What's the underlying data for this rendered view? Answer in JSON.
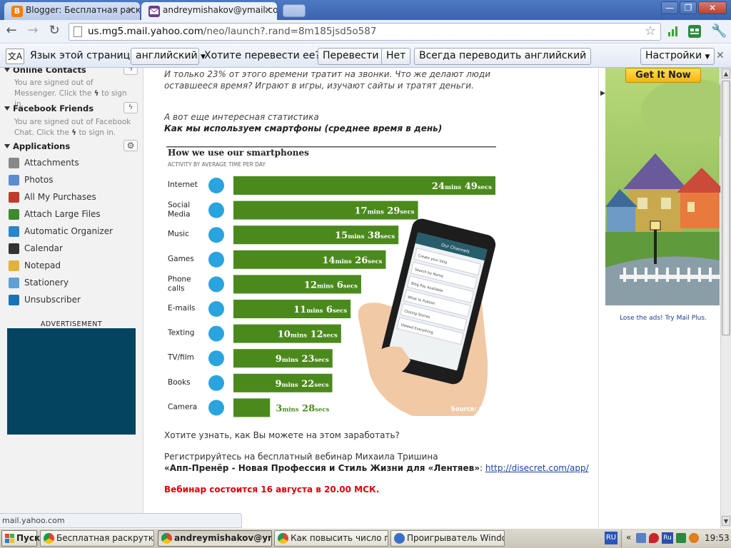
{
  "tabs": [
    {
      "title": "Blogger: Бесплатная раскру",
      "state": "inactive",
      "icon": "blogger-icon",
      "color": "#f57d00"
    },
    {
      "title": "andreymishakov@ymail.com - ",
      "state": "active",
      "icon": "yahoo-mail-icon",
      "color": "#6d3e91"
    }
  ],
  "window_controls": {
    "minimize": "—",
    "maximize": "❐",
    "close": "✕"
  },
  "address_bar": {
    "host": "us.mg5.mail.yahoo.com",
    "path": "/neo/launch?.rand=8m185jsd5o587"
  },
  "translate_bar": {
    "question": "Язык этой страницы",
    "language": "английский",
    "prompt": "Хотите перевести ее?",
    "translate_btn": "Перевести",
    "no_btn": "Нет",
    "always_btn": "Всегда переводить английский",
    "settings_btn": "Настройки"
  },
  "sidebar": {
    "online_contacts": {
      "title": "Online Contacts",
      "text_before": "You are signed out of Messenger. Click the",
      "text_after": "to sign in."
    },
    "facebook": {
      "title": "Facebook Friends",
      "text_before": "You are signed out of Facebook Chat. Click the",
      "text_after": "to sign in."
    },
    "applications": {
      "title": "Applications",
      "items": [
        {
          "label": "Attachments",
          "icon": "paperclip-icon",
          "color": "#888888"
        },
        {
          "label": "Photos",
          "icon": "photos-icon",
          "color": "#5a8ccf"
        },
        {
          "label": "All My Purchases",
          "icon": "purchases-icon",
          "color": "#c0392b"
        },
        {
          "label": "Attach Large Files",
          "icon": "plane-icon",
          "color": "#3c8a2e"
        },
        {
          "label": "Automatic Organizer",
          "icon": "oib-icon",
          "color": "#2b86c9"
        },
        {
          "label": "Calendar",
          "icon": "calendar-icon",
          "color": "#333333"
        },
        {
          "label": "Notepad",
          "icon": "notepad-icon",
          "color": "#e2b23a"
        },
        {
          "label": "Stationery",
          "icon": "stationery-icon",
          "color": "#5fa0d8"
        },
        {
          "label": "Unsubscriber",
          "icon": "unsubscriber-icon",
          "color": "#1a72b8"
        }
      ]
    },
    "advertisement_label": "ADVERTISEMENT"
  },
  "status_bubble": "mail.yahoo.com",
  "email": {
    "line1": "И только 23% от этого времени тратит на звонки. Что же делают люди",
    "line2": "оставшееся  время? Играют в игры, изучают сайты и тратят деньги.",
    "line3": "А вот еще интересная статистика",
    "line4": "Как мы используем смартфоны (среднее время в день)",
    "question": "Хотите узнать, как Вы можете на этом заработать?",
    "register": "Регистрируйтесь на бесплатный вебинар Михаила Тришина",
    "webinar_title": "«Апп-Пренёр - Новая Профессия и Стиль Жизни для «Лентяев»",
    "webinar_sep": ":",
    "webinar_link": "http://disecret.com/app/",
    "date_line": "Вебинар состоится 16 августа в 20.00 МСК."
  },
  "chart_data": {
    "type": "bar",
    "title": "How we use our smartphones",
    "subtitle": "ACTIVITY BY AVERAGE TIME PER DAY",
    "categories": [
      "Internet",
      "Social Media",
      "Music",
      "Games",
      "Phone calls",
      "E-mails",
      "Texting",
      "TV/film",
      "Books",
      "Camera"
    ],
    "category_lines": [
      [
        "Internet"
      ],
      [
        "Social",
        "Media"
      ],
      [
        "Music"
      ],
      [
        "Games"
      ],
      [
        "Phone",
        "calls"
      ],
      [
        "E-mails"
      ],
      [
        "Texting"
      ],
      [
        "TV/film"
      ],
      [
        "Books"
      ],
      [
        "Camera"
      ]
    ],
    "icons": [
      "globe-icon",
      "twitter-bird-icon",
      "music-note-icon",
      "gamepad-icon",
      "phone-icon",
      "envelope-icon",
      "mobile-phone-icon",
      "clapperboard-icon",
      "books-icon",
      "camera-icon"
    ],
    "values": [
      {
        "mins": 24,
        "secs": 49
      },
      {
        "mins": 17,
        "secs": 29
      },
      {
        "mins": 15,
        "secs": 38
      },
      {
        "mins": 14,
        "secs": 26
      },
      {
        "mins": 12,
        "secs": 6
      },
      {
        "mins": 11,
        "secs": 6
      },
      {
        "mins": 10,
        "secs": 12
      },
      {
        "mins": 9,
        "secs": 23
      },
      {
        "mins": 9,
        "secs": 22
      },
      {
        "mins": 3,
        "secs": 28
      }
    ],
    "unit_mins": "mins",
    "unit_secs": "secs",
    "source_label": "Source:",
    "source": "O2",
    "bar_color": "#4a8a1c",
    "icon_color": "#2aa4de",
    "phone_header": "Our Channels",
    "phone_menu": [
      "Create your blog",
      "Search by Name",
      "Blog Pay Available",
      "What to Publish",
      "Closing Stories",
      "Viewed Everything"
    ]
  },
  "right_ad": {
    "button": "Get It Now",
    "lose_ads": "Lose the ads! Try Mail Plus."
  },
  "taskbar": {
    "start": "Пуск",
    "tasks": [
      {
        "label": "Бесплатная раскрутка ...",
        "icon": "chrome-icon",
        "active": false
      },
      {
        "label": "andreymishakov@ym...",
        "icon": "chrome-icon",
        "active": true
      },
      {
        "label": "Как повысить число пр...",
        "icon": "chrome-icon",
        "active": false
      },
      {
        "label": "Проигрыватель Windo...",
        "icon": "media-player-icon",
        "active": false
      }
    ],
    "lang": "RU",
    "lang2": "Ru",
    "clock": "19:53"
  }
}
